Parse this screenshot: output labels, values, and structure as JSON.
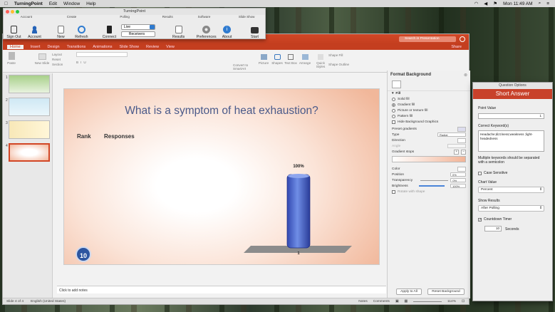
{
  "menubar": {
    "apple": "",
    "app": "TurningPoint",
    "items": [
      "Edit",
      "Window",
      "Help"
    ],
    "clock": "Mon 11:49 AM"
  },
  "turningpoint": {
    "title": "TurningPoint",
    "groups": [
      "Account",
      "Create",
      "Polling",
      "Results",
      "Software",
      "Slide Show"
    ],
    "buttons": {
      "sign_out": "Sign Out",
      "account": "Account",
      "new": "New",
      "refresh": "Refresh",
      "connect": "Connect",
      "results": "Results",
      "preferences": "Preferences",
      "about": "About",
      "start": "Start"
    },
    "polling_mode": "Live",
    "receivers": "Receivers"
  },
  "ppt": {
    "search_placeholder": "Search in Presentation",
    "share": "Share",
    "tabs": [
      "Home",
      "Insert",
      "Design",
      "Transitions",
      "Animations",
      "Slide Show",
      "Review",
      "View"
    ],
    "ribbon": {
      "paste": "Paste",
      "new_slide": "New Slide",
      "layout": "Layout",
      "reset": "Reset",
      "section": "Section",
      "convert": "Convert to SmartArt",
      "picture": "Picture",
      "shapes": "Shapes",
      "text_box": "Text Box",
      "arrange": "Arrange",
      "quick_styles": "Quick Styles",
      "shape_fill": "Shape Fill",
      "shape_outline": "Shape Outline"
    },
    "thumb_numbers": [
      "1",
      "2",
      "3",
      "4"
    ],
    "notes_placeholder": "Click to add notes",
    "status": {
      "slide": "Slide 4 of 4",
      "language": "English (United States)",
      "notes": "Notes",
      "comments": "Comments",
      "zoom": "114%"
    }
  },
  "slide": {
    "title": "What is a symptom of heat exhaustion?",
    "rank_label": "Rank",
    "responses_label": "Responses",
    "badge": "10"
  },
  "chart_data": {
    "type": "bar",
    "categories": [
      "1"
    ],
    "values": [
      100
    ],
    "value_labels": [
      "100%"
    ],
    "ylim": [
      0,
      100
    ],
    "title": "",
    "xlabel": "",
    "ylabel": ""
  },
  "format_background": {
    "title": "Format Background",
    "section": "Fill",
    "options": [
      "Solid fill",
      "Gradient fill",
      "Picture or texture fill",
      "Pattern fill"
    ],
    "selected": "Gradient fill",
    "hide_graphics": "Hide Background Graphics",
    "preset": "Preset gradients",
    "type_label": "Type",
    "type_value": "Radial",
    "direction": "Direction",
    "angle": "Angle",
    "stops": "Gradient stops",
    "color": "Color",
    "position": "Position",
    "position_value": "0%",
    "transparency": "Transparency",
    "transparency_value": "0%",
    "brightness": "Brightness",
    "brightness_value": "100%",
    "rotate": "Rotate with shape",
    "apply_all": "Apply to All",
    "reset_bg": "Reset Background"
  },
  "question_options": {
    "title": "Question Options",
    "band": "Short Answer",
    "point_value_label": "Point Value",
    "point_value": "1",
    "keywords_label": "Correct Keyword(s)",
    "keywords": "Headache;dizziness;weakness ;light-headedness",
    "keywords_note": "Multiple keywords should be separated with a semicolon",
    "case_sensitive": "Case Sensitive",
    "chart_value_label": "Chart Value",
    "chart_value": "Percent",
    "show_results_label": "Show Results",
    "show_results": "After Polling",
    "countdown_label": "Countdown Timer",
    "seconds_value": "10",
    "seconds_label": "Seconds"
  }
}
